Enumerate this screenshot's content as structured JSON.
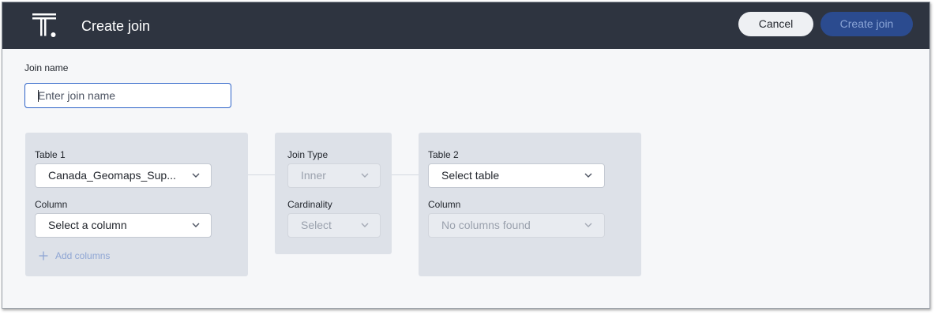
{
  "header": {
    "title": "Create join",
    "cancel_label": "Cancel",
    "create_label": "Create join",
    "logo_icon": "thoughtspot-logo-icon"
  },
  "join_name": {
    "label": "Join name",
    "placeholder": "Enter join name",
    "value": ""
  },
  "table1": {
    "label": "Table 1",
    "selected": "Canada_Geomaps_Sup...",
    "column_label": "Column",
    "column_value": "Select a column",
    "add_columns": "Add columns"
  },
  "join": {
    "type_label": "Join Type",
    "type_value": "Inner",
    "cardinality_label": "Cardinality",
    "cardinality_value": "Select"
  },
  "table2": {
    "label": "Table 2",
    "selected": "Select table",
    "column_label": "Column",
    "column_value": "No columns found"
  },
  "colors": {
    "header_bg": "#2e3440",
    "primary": "#2b4b8f",
    "panel_bg": "#dde1e8",
    "focus_border": "#2d63c8"
  }
}
